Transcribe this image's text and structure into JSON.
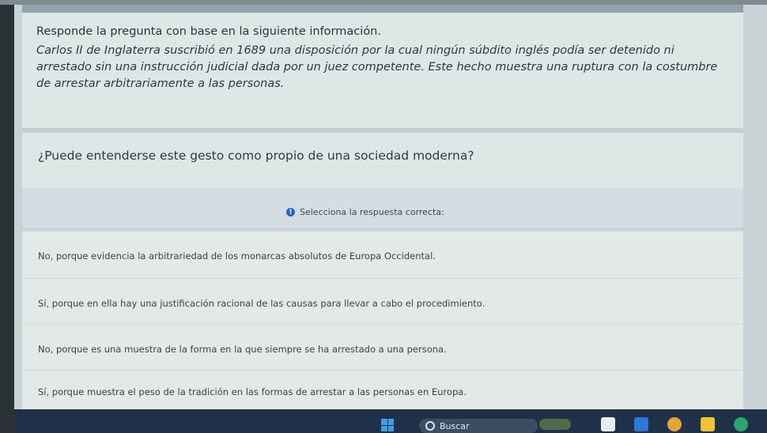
{
  "info": {
    "title": "Responde la pregunta con base en la siguiente información.",
    "body": "Carlos II de Inglaterra suscribió en 1689 una disposición por la cual ningún súbdito inglés podía ser detenido ni arrestado sin una instrucción judicial dada por un juez competente. Este hecho muestra una ruptura con la costumbre de arrestar arbitrariamente a las personas."
  },
  "question": "¿Puede entenderse este gesto como propio de una sociedad moderna?",
  "prompt": "Selecciona la respuesta correcta:",
  "options": [
    "No, porque evidencia la arbitrariedad de los monarcas absolutos de Europa Occidental.",
    "Sí, porque en ella hay una justificación racional de las causas para llevar a cabo el procedimiento.",
    "No, porque es una muestra de la forma en la que siempre se ha arrestado a una persona.",
    "Sí, porque muestra el peso de la tradición en las formas de arrestar a las personas en Europa."
  ],
  "taskbar": {
    "search_placeholder": "Buscar",
    "icons": [
      "windows-start-icon",
      "search-icon",
      "widgets-icon",
      "file-manager-icon",
      "app-icon",
      "browser-icon",
      "folder-icon",
      "edge-icon"
    ]
  },
  "colors": {
    "taskbar": "#1f3148",
    "info_dot": "#1e64c8"
  }
}
